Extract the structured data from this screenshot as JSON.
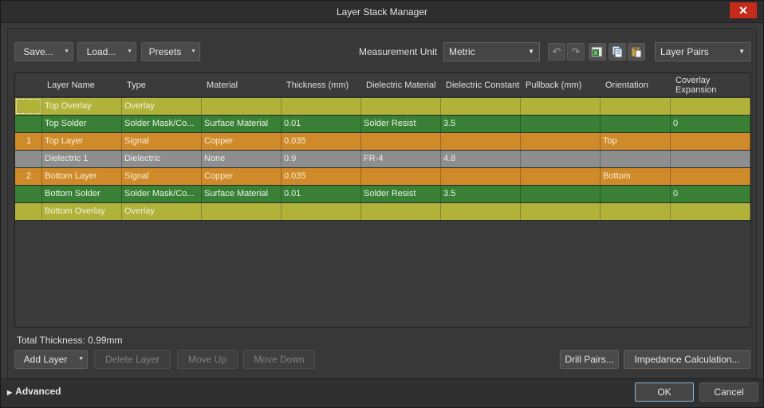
{
  "window": {
    "title": "Layer Stack Manager",
    "close_glyph": "✕"
  },
  "toolbar": {
    "save_label": "Save...",
    "load_label": "Load...",
    "presets_label": "Presets",
    "measurement_unit_label": "Measurement Unit",
    "measurement_unit_value": "Metric",
    "layer_pairs_value": "Layer Pairs"
  },
  "grid": {
    "headers": [
      "",
      "Layer Name",
      "Type",
      "Material",
      "Thickness (mm)",
      "Dielectric Material",
      "Dielectric Constant",
      "Pullback (mm)",
      "Orientation",
      "Coverlay Expansion"
    ],
    "rows": [
      {
        "kind": "overlay",
        "num": "",
        "name": "Top Overlay",
        "type": "Overlay",
        "material": "",
        "thickness": "",
        "diel_material": "",
        "diel_constant": "",
        "pullback": "",
        "orientation": "",
        "coverlay": ""
      },
      {
        "kind": "solder",
        "num": "",
        "name": "Top Solder",
        "type": "Solder Mask/Co...",
        "material": "Surface Material",
        "thickness": "0.01",
        "diel_material": "Solder Resist",
        "diel_constant": "3.5",
        "pullback": "",
        "orientation": "",
        "coverlay": "0"
      },
      {
        "kind": "signal",
        "num": "1",
        "name": "Top Layer",
        "type": "Signal",
        "material": "Copper",
        "thickness": "0.035",
        "diel_material": "",
        "diel_constant": "",
        "pullback": "",
        "orientation": "Top",
        "coverlay": ""
      },
      {
        "kind": "dielectric",
        "num": "",
        "name": "Dielectric 1",
        "type": "Dielectric",
        "material": "None",
        "thickness": "0.9",
        "diel_material": "FR-4",
        "diel_constant": "4.8",
        "pullback": "",
        "orientation": "",
        "coverlay": ""
      },
      {
        "kind": "signal",
        "num": "2",
        "name": "Bottom Layer",
        "type": "Signal",
        "material": "Copper",
        "thickness": "0.035",
        "diel_material": "",
        "diel_constant": "",
        "pullback": "",
        "orientation": "Bottom",
        "coverlay": ""
      },
      {
        "kind": "solder",
        "num": "",
        "name": "Bottom Solder",
        "type": "Solder Mask/Co...",
        "material": "Surface Material",
        "thickness": "0.01",
        "diel_material": "Solder Resist",
        "diel_constant": "3.5",
        "pullback": "",
        "orientation": "",
        "coverlay": "0"
      },
      {
        "kind": "overlay",
        "num": "",
        "name": "Bottom Overlay",
        "type": "Overlay",
        "material": "",
        "thickness": "",
        "diel_material": "",
        "diel_constant": "",
        "pullback": "",
        "orientation": "",
        "coverlay": ""
      }
    ]
  },
  "summary": {
    "total_thickness": "Total Thickness: 0.99mm"
  },
  "actions": {
    "add_layer": "Add Layer",
    "delete_layer": "Delete Layer",
    "move_up": "Move Up",
    "move_down": "Move Down",
    "drill_pairs": "Drill Pairs...",
    "impedance": "Impedance Calculation..."
  },
  "footer": {
    "advanced_label": "Advanced",
    "ok_label": "OK",
    "cancel_label": "Cancel"
  },
  "colors": {
    "overlay": "#b1b23a",
    "solder": "#3a7f36",
    "signal": "#cf8a2a",
    "dielectric": "#8e8e8e"
  }
}
